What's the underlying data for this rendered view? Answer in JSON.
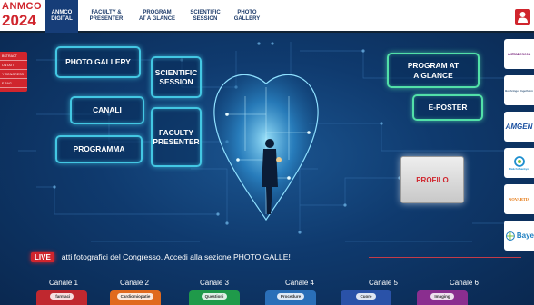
{
  "header": {
    "logo_line1": "ANMCO",
    "logo_line2": "2024",
    "tabs": [
      {
        "label": "ANMCO\nDIGITAL",
        "active": true
      },
      {
        "label": "FACULTY &\nPRESENTER",
        "active": false
      },
      {
        "label": "PROGRAM\nAT A GLANCE",
        "active": false
      },
      {
        "label": "SCIENTIFIC\nSESSION",
        "active": false
      },
      {
        "label": "PHOTO\nGALLERY",
        "active": false
      }
    ],
    "user_icon": "user-icon"
  },
  "left_menu": {
    "items": [
      "BSTRACT",
      "ONTATTI",
      "Y CONGRESS",
      "F BAG"
    ]
  },
  "panels": {
    "photo_gallery": "PHOTO GALLERY",
    "scientific_session": "SCIENTIFIC\nSESSION",
    "canali": "CANALI",
    "faculty_presenter": "FACULTY\nPRESENTER",
    "programma": "PROGRAMMA",
    "program_at_a_glance": "PROGRAM AT\nA GLANCE",
    "e_poster": "E-POSTER",
    "profilo": "PROFILO"
  },
  "sponsors": [
    {
      "name": "AstraZeneca",
      "color": "#7b2a7f"
    },
    {
      "name": "Boehringer Ingelheim",
      "color": "#4a6a8a"
    },
    {
      "name": "AMGEN",
      "color": "#1a4fa0"
    },
    {
      "name": "Daiichi-Sankyo",
      "color": "#1e8fcf"
    },
    {
      "name": "NOVARTIS",
      "color": "#e5740a"
    },
    {
      "name": "Baye",
      "color": "#1e7fc1"
    }
  ],
  "live": {
    "badge": "LIVE",
    "ticker": "atti fotografici del Congresso. Accedi alla sezione PHOTO GALLE!"
  },
  "channels": [
    {
      "label": "Canale 1",
      "thumb": "i farmaci",
      "color": "#c0282f"
    },
    {
      "label": "Canale 2",
      "thumb": "Cardiomiopatie",
      "color": "#e06a1e"
    },
    {
      "label": "Canale 3",
      "thumb": "Questioni",
      "color": "#1f9a4a"
    },
    {
      "label": "Canale 4",
      "thumb": "Procedure",
      "color": "#2a6fb8"
    },
    {
      "label": "Canale 5",
      "thumb": "Cuore",
      "color": "#2a52a8"
    },
    {
      "label": "Canale 6",
      "thumb": "Imaging",
      "color": "#8a2e8f"
    }
  ],
  "colors": {
    "brand_red": "#d0252d",
    "navy": "#0a2a52",
    "panel_cyan": "#43c7e3",
    "panel_green": "#52e0a8"
  }
}
